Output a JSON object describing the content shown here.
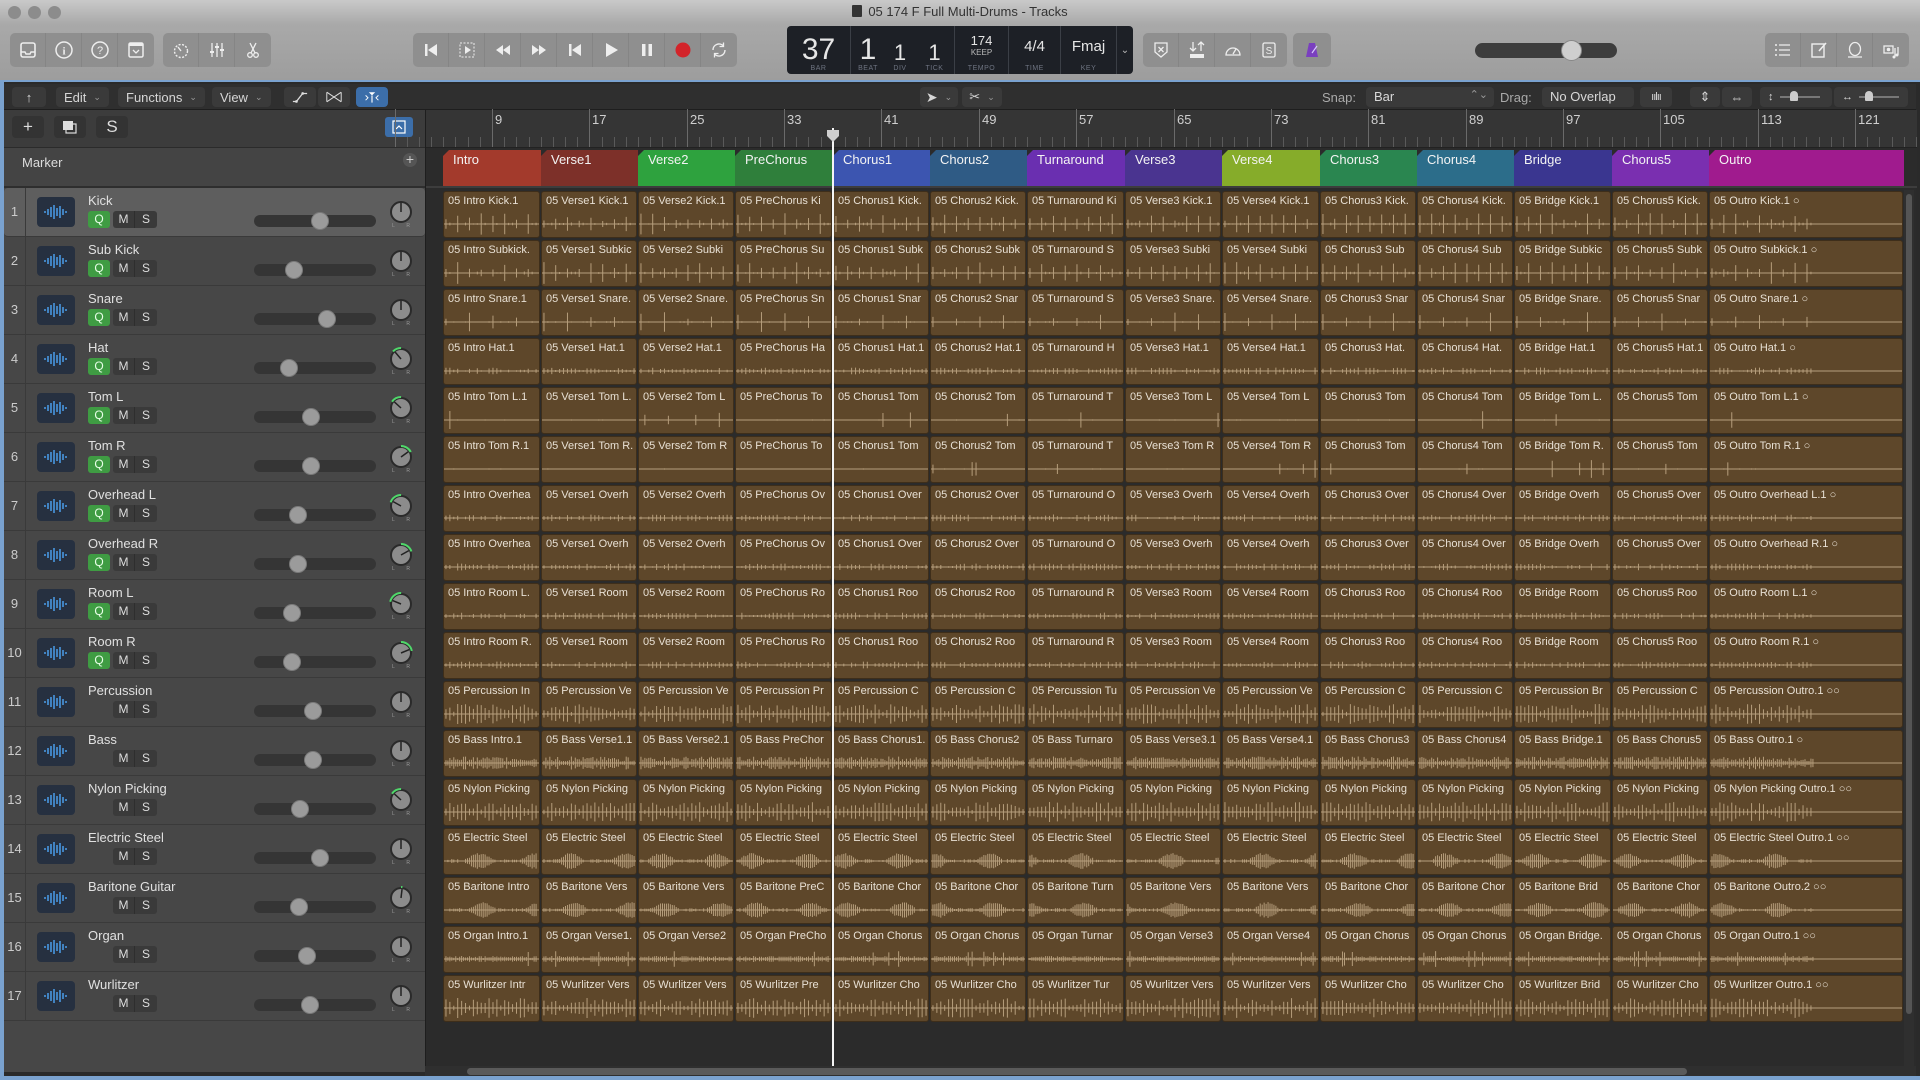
{
  "window": {
    "title": "05 174 F Full Multi-Drums - Tracks"
  },
  "toolbar": {
    "left_buttons": [
      {
        "name": "library-icon"
      },
      {
        "name": "inspector-icon"
      },
      {
        "name": "quick-help-icon"
      },
      {
        "name": "toolbar-icon"
      }
    ],
    "edit_buttons": [
      {
        "name": "smart-controls-icon"
      },
      {
        "name": "mixer-icon"
      },
      {
        "name": "editors-icon"
      }
    ],
    "transport": [
      {
        "name": "go-to-beginning-icon"
      },
      {
        "name": "play-from-selection-icon"
      },
      {
        "name": "rewind-icon"
      },
      {
        "name": "fast-forward-icon"
      },
      {
        "name": "go-to-start-icon"
      },
      {
        "name": "play-icon"
      },
      {
        "name": "pause-icon"
      },
      {
        "name": "record-icon"
      },
      {
        "name": "cycle-icon"
      }
    ],
    "lcd": {
      "bar": "37",
      "beat": "1",
      "div": "1",
      "tick": "1",
      "bar_label": "BAR",
      "beat_label": "BEAT",
      "div_label": "DIV",
      "tick_label": "TICK",
      "tempo": "174",
      "tempo_mode": "KEEP",
      "tempo_label": "TEMPO",
      "time_signature": "4/4",
      "time_label": "TIME",
      "key": "Fmaj",
      "key_label": "KEY"
    },
    "right_buttons": [
      {
        "name": "replace-icon"
      },
      {
        "name": "count-in-icon"
      },
      {
        "name": "tuner-icon"
      },
      {
        "name": "solo-icon"
      },
      {
        "name": "metronome-icon"
      }
    ],
    "master_volume": 0.72,
    "far_right_buttons": [
      {
        "name": "list-editors-icon"
      },
      {
        "name": "note-pad-icon"
      },
      {
        "name": "loop-browser-icon"
      },
      {
        "name": "media-browser-icon"
      }
    ]
  },
  "menubar": {
    "back_label": "↑",
    "edit": "Edit",
    "functions": "Functions",
    "view": "View",
    "snap_label": "Snap:",
    "snap_value": "Bar",
    "drag_label": "Drag:",
    "drag_value": "No Overlap"
  },
  "left_panel": {
    "add_label": "+",
    "solo_label": "S",
    "marker_label": "Marker"
  },
  "ruler": {
    "bars": [
      9,
      17,
      25,
      33,
      41,
      49,
      57,
      65,
      73,
      81,
      89,
      97,
      105,
      113,
      121
    ]
  },
  "playhead_bar": 37,
  "markers": [
    {
      "name": "Intro",
      "start": 5,
      "end": 13,
      "color": "#a33a2c"
    },
    {
      "name": "Verse1",
      "start": 13,
      "end": 21,
      "color": "#7d3029"
    },
    {
      "name": "Verse2",
      "start": 21,
      "end": 29,
      "color": "#2ea23e"
    },
    {
      "name": "PreChorus",
      "start": 29,
      "end": 37,
      "color": "#2f7f3b"
    },
    {
      "name": "Chorus1",
      "start": 37,
      "end": 45,
      "color": "#3c55b0"
    },
    {
      "name": "Chorus2",
      "start": 45,
      "end": 53,
      "color": "#2f5b85"
    },
    {
      "name": "Turnaround",
      "start": 53,
      "end": 61,
      "color": "#6a2fb0"
    },
    {
      "name": "Verse3",
      "start": 61,
      "end": 69,
      "color": "#4a3490"
    },
    {
      "name": "Verse4",
      "start": 69,
      "end": 77,
      "color": "#86ac2a"
    },
    {
      "name": "Chorus3",
      "start": 77,
      "end": 85,
      "color": "#2a8650"
    },
    {
      "name": "Chorus4",
      "start": 85,
      "end": 93,
      "color": "#2c6d8a"
    },
    {
      "name": "Bridge",
      "start": 93,
      "end": 101,
      "color": "#3a3690"
    },
    {
      "name": "Chorus5",
      "start": 101,
      "end": 109,
      "color": "#7a2fb0"
    },
    {
      "name": "Outro",
      "start": 109,
      "end": 125,
      "color": "#a01b8e"
    }
  ],
  "tracks": [
    {
      "number": "1",
      "name": "Kick",
      "q": true,
      "volume": 0.55,
      "pan": 0,
      "selected": true,
      "regions": [
        "05 Intro Kick.1",
        "05 Verse1 Kick.1",
        "05 Verse2 Kick.1",
        "05 PreChorus Ki",
        "05 Chorus1 Kick.",
        "05 Chorus2 Kick.",
        "05 Turnaround Ki",
        "05 Verse3 Kick.1",
        "05 Verse4 Kick.1",
        "05 Chorus3 Kick.",
        "05 Chorus4 Kick.",
        "05 Bridge Kick.1",
        "05 Chorus5 Kick.",
        "05 Outro Kick.1 ○"
      ],
      "wave": "kick"
    },
    {
      "number": "2",
      "name": "Sub Kick",
      "q": true,
      "volume": 0.3,
      "pan": 0,
      "regions": [
        "05 Intro Subkick.",
        "05 Verse1 Subkic",
        "05 Verse2 Subki",
        "05 PreChorus Su",
        "05 Chorus1 Subk",
        "05 Chorus2 Subk",
        "05 Turnaround S",
        "05 Verse3 Subki",
        "05 Verse4 Subki",
        "05 Chorus3 Sub",
        "05 Chorus4 Sub",
        "05 Bridge Subkic",
        "05 Chorus5 Subk",
        "05 Outro Subkick.1 ○"
      ],
      "wave": "kick"
    },
    {
      "number": "3",
      "name": "Snare",
      "q": true,
      "volume": 0.62,
      "pan": 0,
      "regions": [
        "05 Intro Snare.1",
        "05 Verse1 Snare.",
        "05 Verse2 Snare.",
        "05 PreChorus Sn",
        "05 Chorus1 Snar",
        "05 Chorus2 Snar",
        "05 Turnaround S",
        "05 Verse3 Snare.",
        "05 Verse4 Snare.",
        "05 Chorus3 Snar",
        "05 Chorus4 Snar",
        "05 Bridge Snare.",
        "05 Chorus5 Snar",
        "05 Outro Snare.1 ○"
      ],
      "wave": "snare"
    },
    {
      "number": "4",
      "name": "Hat",
      "q": true,
      "volume": 0.25,
      "pan": -0.3,
      "regions": [
        "05 Intro Hat.1",
        "05 Verse1 Hat.1",
        "05 Verse2 Hat.1",
        "05 PreChorus Ha",
        "05 Chorus1 Hat.1",
        "05 Chorus2 Hat.1",
        "05 Turnaround H",
        "05 Verse3 Hat.1",
        "05 Verse4 Hat.1",
        "05 Chorus3 Hat.",
        "05 Chorus4 Hat.",
        "05 Bridge Hat.1",
        "05 Chorus5 Hat.1",
        "05 Outro Hat.1 ○"
      ],
      "wave": "hat"
    },
    {
      "number": "5",
      "name": "Tom L",
      "q": true,
      "volume": 0.46,
      "pan": -0.35,
      "regions": [
        "05 Intro Tom L.1",
        "05 Verse1 Tom L.",
        "05 Verse2 Tom L",
        "05 PreChorus To",
        "05 Chorus1 Tom",
        "05 Chorus2 Tom",
        "05 Turnaround T",
        "05 Verse3 Tom L",
        "05 Verse4 Tom L",
        "05 Chorus3 Tom",
        "05 Chorus4 Tom",
        "05 Bridge Tom L.",
        "05 Chorus5 Tom",
        "05 Outro Tom L.1 ○"
      ],
      "wave": "tom"
    },
    {
      "number": "6",
      "name": "Tom R",
      "q": true,
      "volume": 0.46,
      "pan": 0.4,
      "regions": [
        "05 Intro Tom R.1",
        "05 Verse1 Tom R.",
        "05 Verse2 Tom R",
        "05 PreChorus To",
        "05 Chorus1 Tom",
        "05 Chorus2 Tom",
        "05 Turnaround T",
        "05 Verse3 Tom R",
        "05 Verse4 Tom R",
        "05 Chorus3 Tom",
        "05 Chorus4 Tom",
        "05 Bridge Tom R.",
        "05 Chorus5 Tom",
        "05 Outro Tom R.1 ○"
      ],
      "wave": "tom"
    },
    {
      "number": "7",
      "name": "Overhead L",
      "q": true,
      "volume": 0.34,
      "pan": -0.45,
      "regions": [
        "05 Intro Overhea",
        "05 Verse1 Overh",
        "05 Verse2 Overh",
        "05 PreChorus Ov",
        "05 Chorus1 Over",
        "05 Chorus2 Over",
        "05 Turnaround O",
        "05 Verse3 Overh",
        "05 Verse4 Overh",
        "05 Chorus3 Over",
        "05 Chorus4 Over",
        "05 Bridge Overh",
        "05 Chorus5 Over",
        "05 Outro Overhead L.1 ○"
      ],
      "wave": "hat"
    },
    {
      "number": "8",
      "name": "Overhead R",
      "q": true,
      "volume": 0.34,
      "pan": 0.45,
      "regions": [
        "05 Intro Overhea",
        "05 Verse1 Overh",
        "05 Verse2 Overh",
        "05 PreChorus Ov",
        "05 Chorus1 Over",
        "05 Chorus2 Over",
        "05 Turnaround O",
        "05 Verse3 Overh",
        "05 Verse4 Overh",
        "05 Chorus3 Over",
        "05 Chorus4 Over",
        "05 Bridge Overh",
        "05 Chorus5 Over",
        "05 Outro Overhead R.1 ○"
      ],
      "wave": "hat"
    },
    {
      "number": "9",
      "name": "Room L",
      "q": true,
      "volume": 0.28,
      "pan": -0.5,
      "regions": [
        "05 Intro Room L.",
        "05 Verse1 Room",
        "05 Verse2 Room",
        "05 PreChorus Ro",
        "05 Chorus1 Roo",
        "05 Chorus2 Roo",
        "05 Turnaround R",
        "05 Verse3 Room",
        "05 Verse4 Room",
        "05 Chorus3 Roo",
        "05 Chorus4 Roo",
        "05 Bridge Room",
        "05 Chorus5 Roo",
        "05 Outro Room L.1 ○"
      ],
      "wave": "hat"
    },
    {
      "number": "10",
      "name": "Room R",
      "q": true,
      "volume": 0.28,
      "pan": 0.5,
      "regions": [
        "05 Intro Room R.",
        "05 Verse1 Room",
        "05 Verse2 Room",
        "05 PreChorus Ro",
        "05 Chorus1 Roo",
        "05 Chorus2 Roo",
        "05 Turnaround R",
        "05 Verse3 Room",
        "05 Verse4 Room",
        "05 Chorus3 Roo",
        "05 Chorus4 Roo",
        "05 Bridge Room",
        "05 Chorus5 Roo",
        "05 Outro Room R.1 ○"
      ],
      "wave": "hat"
    },
    {
      "number": "11",
      "name": "Percussion",
      "q": false,
      "volume": 0.48,
      "pan": 0,
      "regions": [
        "05 Percussion In",
        "05 Percussion Ve",
        "05 Percussion Ve",
        "05 Percussion Pr",
        "05 Percussion C",
        "05 Percussion C",
        "05 Percussion Tu",
        "05 Percussion Ve",
        "05 Percussion Ve",
        "05 Percussion C",
        "05 Percussion C",
        "05 Percussion Br",
        "05 Percussion C",
        "05 Percussion Outro.1 ○○"
      ],
      "wave": "perc"
    },
    {
      "number": "12",
      "name": "Bass",
      "q": false,
      "volume": 0.48,
      "pan": 0,
      "regions": [
        "05 Bass Intro.1",
        "05 Bass Verse1.1",
        "05 Bass Verse2.1",
        "05 Bass PreChor",
        "05 Bass Chorus1.",
        "05 Bass Chorus2",
        "05 Bass Turnaro",
        "05 Bass Verse3.1",
        "05 Bass Verse4.1",
        "05 Bass Chorus3",
        "05 Bass Chorus4",
        "05 Bass Bridge.1",
        "05 Bass Chorus5",
        "05 Bass Outro.1 ○"
      ],
      "wave": "bass"
    },
    {
      "number": "13",
      "name": "Nylon Picking",
      "q": false,
      "volume": 0.36,
      "pan": -0.35,
      "regions": [
        "05 Nylon Picking",
        "05 Nylon Picking",
        "05 Nylon Picking",
        "05 Nylon Picking",
        "05 Nylon Picking",
        "05 Nylon Picking",
        "05 Nylon Picking",
        "05 Nylon Picking",
        "05 Nylon Picking",
        "05 Nylon Picking",
        "05 Nylon Picking",
        "05 Nylon Picking",
        "05 Nylon Picking",
        "05 Nylon Picking Outro.1 ○○"
      ],
      "wave": "perc"
    },
    {
      "number": "14",
      "name": "Electric Steel",
      "q": false,
      "volume": 0.55,
      "pan": 0,
      "regions": [
        "05 Electric Steel",
        "05 Electric Steel",
        "05 Electric Steel",
        "05 Electric Steel",
        "05 Electric Steel",
        "05 Electric Steel",
        "05 Electric Steel",
        "05 Electric Steel",
        "05 Electric Steel",
        "05 Electric Steel",
        "05 Electric Steel",
        "05 Electric Steel",
        "05 Electric Steel",
        "05 Electric Steel Outro.1 ○○"
      ],
      "wave": "swell"
    },
    {
      "number": "15",
      "name": "Baritone Guitar",
      "q": false,
      "volume": 0.35,
      "pan": 0.05,
      "regions": [
        "05 Baritone Intro",
        "05 Baritone Vers",
        "05 Baritone Vers",
        "05 Baritone PreC",
        "05 Baritone Chor",
        "05 Baritone Chor",
        "05 Baritone Turn",
        "05 Baritone Vers",
        "05 Baritone Vers",
        "05 Baritone Chor",
        "05 Baritone Chor",
        "05 Baritone Brid",
        "05 Baritone Chor",
        "05 Baritone Outro.2 ○○"
      ],
      "wave": "swell"
    },
    {
      "number": "16",
      "name": "Organ",
      "q": false,
      "volume": 0.42,
      "pan": 0,
      "regions": [
        "05 Organ Intro.1",
        "05 Organ Verse1.",
        "05 Organ Verse2",
        "05 Organ PreCho",
        "05 Organ Chorus",
        "05 Organ Chorus",
        "05 Organ Turnar",
        "05 Organ Verse3",
        "05 Organ Verse4",
        "05 Organ Chorus",
        "05 Organ Chorus",
        "05 Organ Bridge.",
        "05 Organ Chorus",
        "05 Organ Outro.1 ○○"
      ],
      "wave": "organ"
    },
    {
      "number": "17",
      "name": "Wurlitzer",
      "q": false,
      "volume": 0.45,
      "pan": 0,
      "regions": [
        "05 Wurlitzer Intr",
        "05 Wurlitzer Vers",
        "05 Wurlitzer Vers",
        "05 Wurlitzer Pre",
        "05 Wurlitzer Cho",
        "05 Wurlitzer Cho",
        "05 Wurlitzer Tur",
        "05 Wurlitzer Vers",
        "05 Wurlitzer Vers",
        "05 Wurlitzer Cho",
        "05 Wurlitzer Cho",
        "05 Wurlitzer Brid",
        "05 Wurlitzer Cho",
        "05 Wurlitzer Outro.1 ○○"
      ],
      "wave": "perc"
    }
  ],
  "colors": {
    "region": "#5e472a",
    "q_on": "#3f9c43",
    "accent": "#3c6ea9",
    "pan_arc": "#4fd86a"
  }
}
